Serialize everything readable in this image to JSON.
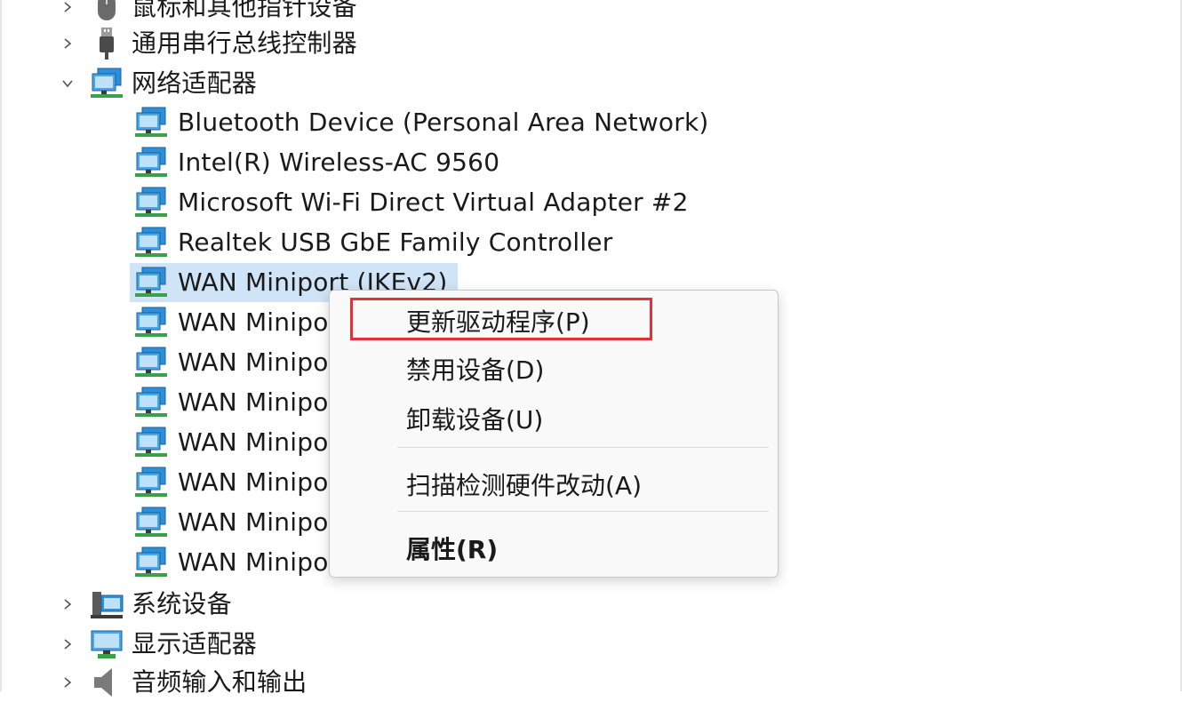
{
  "tree": {
    "categories_top": [
      {
        "label": "鼠标和其他指针设备",
        "expanded": false,
        "icon": "mouse-icon"
      },
      {
        "label": "通用串行总线控制器",
        "expanded": false,
        "icon": "usb-icon"
      },
      {
        "label": "网络适配器",
        "expanded": true,
        "icon": "network-adapter-icon"
      }
    ],
    "network_children": [
      {
        "label": "Bluetooth Device (Personal Area Network)"
      },
      {
        "label": "Intel(R) Wireless-AC 9560"
      },
      {
        "label": "Microsoft Wi-Fi Direct Virtual Adapter #2"
      },
      {
        "label": "Realtek USB GbE Family Controller"
      },
      {
        "label": "WAN Miniport (IKEv2)",
        "selected": true
      },
      {
        "label": "WAN Minipo"
      },
      {
        "label": "WAN Minipo"
      },
      {
        "label": "WAN Minipo"
      },
      {
        "label": "WAN Minipo"
      },
      {
        "label": "WAN Minipo"
      },
      {
        "label": "WAN Minipo"
      },
      {
        "label": "WAN Minipo"
      }
    ],
    "categories_bottom": [
      {
        "label": "系统设备",
        "expanded": false,
        "icon": "system-device-icon"
      },
      {
        "label": "显示适配器",
        "expanded": false,
        "icon": "display-adapter-icon"
      },
      {
        "label": "音频输入和输出",
        "expanded": false,
        "icon": "audio-icon"
      }
    ]
  },
  "context_menu": {
    "items": [
      {
        "label": "更新驱动程序(P)",
        "highlighted": true
      },
      {
        "label": "禁用设备(D)"
      },
      {
        "label": "卸载设备(U)"
      },
      {
        "label": "扫描检测硬件改动(A)"
      },
      {
        "label": "属性(R)",
        "bold": true
      }
    ]
  },
  "colors": {
    "selection": "#cfe4f6",
    "highlight_border": "#e0323a",
    "monitor_blue": "#2d8fd8",
    "network_green": "#3aa14a"
  }
}
